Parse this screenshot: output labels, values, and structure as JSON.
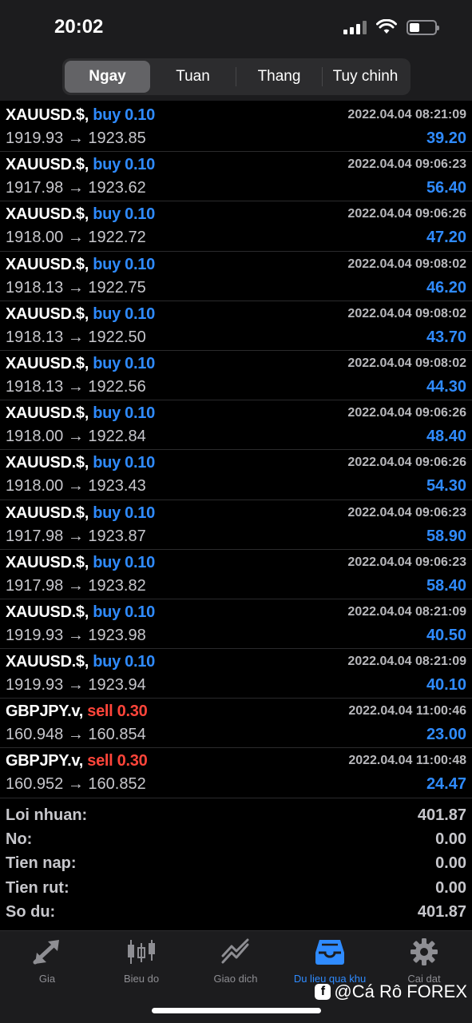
{
  "status": {
    "time": "20:02"
  },
  "segments": [
    {
      "label": "Ngay",
      "active": true
    },
    {
      "label": "Tuan",
      "active": false
    },
    {
      "label": "Thang",
      "active": false
    },
    {
      "label": "Tuy chinh",
      "active": false
    }
  ],
  "deals": [
    {
      "symbol": "XAUUSD.$,",
      "side": "buy 0.10",
      "type": "buy",
      "time": "2022.04.04 08:21:09",
      "prices": "1919.93 → 1923.85",
      "profit": "39.20"
    },
    {
      "symbol": "XAUUSD.$,",
      "side": "buy 0.10",
      "type": "buy",
      "time": "2022.04.04 09:06:23",
      "prices": "1917.98 → 1923.62",
      "profit": "56.40"
    },
    {
      "symbol": "XAUUSD.$,",
      "side": "buy 0.10",
      "type": "buy",
      "time": "2022.04.04 09:06:26",
      "prices": "1918.00 → 1922.72",
      "profit": "47.20"
    },
    {
      "symbol": "XAUUSD.$,",
      "side": "buy 0.10",
      "type": "buy",
      "time": "2022.04.04 09:08:02",
      "prices": "1918.13 → 1922.75",
      "profit": "46.20"
    },
    {
      "symbol": "XAUUSD.$,",
      "side": "buy 0.10",
      "type": "buy",
      "time": "2022.04.04 09:08:02",
      "prices": "1918.13 → 1922.50",
      "profit": "43.70"
    },
    {
      "symbol": "XAUUSD.$,",
      "side": "buy 0.10",
      "type": "buy",
      "time": "2022.04.04 09:08:02",
      "prices": "1918.13 → 1922.56",
      "profit": "44.30"
    },
    {
      "symbol": "XAUUSD.$,",
      "side": "buy 0.10",
      "type": "buy",
      "time": "2022.04.04 09:06:26",
      "prices": "1918.00 → 1922.84",
      "profit": "48.40"
    },
    {
      "symbol": "XAUUSD.$,",
      "side": "buy 0.10",
      "type": "buy",
      "time": "2022.04.04 09:06:26",
      "prices": "1918.00 → 1923.43",
      "profit": "54.30"
    },
    {
      "symbol": "XAUUSD.$,",
      "side": "buy 0.10",
      "type": "buy",
      "time": "2022.04.04 09:06:23",
      "prices": "1917.98 → 1923.87",
      "profit": "58.90"
    },
    {
      "symbol": "XAUUSD.$,",
      "side": "buy 0.10",
      "type": "buy",
      "time": "2022.04.04 09:06:23",
      "prices": "1917.98 → 1923.82",
      "profit": "58.40"
    },
    {
      "symbol": "XAUUSD.$,",
      "side": "buy 0.10",
      "type": "buy",
      "time": "2022.04.04 08:21:09",
      "prices": "1919.93 → 1923.98",
      "profit": "40.50"
    },
    {
      "symbol": "XAUUSD.$,",
      "side": "buy 0.10",
      "type": "buy",
      "time": "2022.04.04 08:21:09",
      "prices": "1919.93 → 1923.94",
      "profit": "40.10"
    },
    {
      "symbol": "GBPJPY.v,",
      "side": "sell 0.30",
      "type": "sell",
      "time": "2022.04.04 11:00:46",
      "prices": "160.948 → 160.854",
      "profit": "23.00"
    },
    {
      "symbol": "GBPJPY.v,",
      "side": "sell 0.30",
      "type": "sell",
      "time": "2022.04.04 11:00:48",
      "prices": "160.952 → 160.852",
      "profit": "24.47"
    }
  ],
  "summary": [
    {
      "label": "Loi nhuan:",
      "value": "401.87"
    },
    {
      "label": "No:",
      "value": "0.00"
    },
    {
      "label": "Tien nap:",
      "value": "0.00"
    },
    {
      "label": "Tien rut:",
      "value": "0.00"
    },
    {
      "label": "So du:",
      "value": "401.87"
    }
  ],
  "tabs": [
    {
      "label": "Gia",
      "icon": "quotes-arrows-icon",
      "active": false
    },
    {
      "label": "Bieu do",
      "icon": "candlestick-chart-icon",
      "active": false
    },
    {
      "label": "Giao dich",
      "icon": "trade-line-icon",
      "active": false
    },
    {
      "label": "Du lieu qua khu",
      "icon": "history-inbox-icon",
      "active": true
    },
    {
      "label": "Cai dat",
      "icon": "gear-icon",
      "active": false
    }
  ],
  "watermark": "@Cá Rô FOREX",
  "colors": {
    "accent": "#2f8bff",
    "sell": "#ff453a",
    "background": "#000000",
    "bar": "#1c1c1e"
  }
}
